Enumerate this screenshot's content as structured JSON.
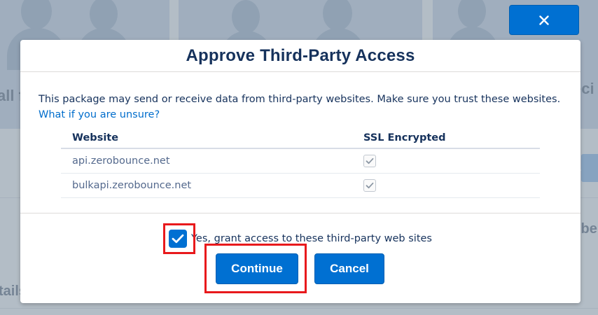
{
  "background": {
    "fragments": [
      "all f",
      "eci",
      "all",
      "ibe",
      "tails"
    ]
  },
  "close_button": {
    "label": "×"
  },
  "modal": {
    "title": "Approve Third-Party Access",
    "description": "This package may send or receive data from third-party websites. Make sure you trust these websites.",
    "help_link": "What if you are unsure?",
    "table": {
      "columns": [
        "Website",
        "SSL Encrypted"
      ],
      "rows": [
        {
          "website": "api.zerobounce.net",
          "ssl_encrypted": true
        },
        {
          "website": "bulkapi.zerobounce.net",
          "ssl_encrypted": true
        }
      ]
    },
    "consent": {
      "label": "Yes, grant access to these third-party web sites",
      "checked": true
    },
    "buttons": {
      "continue": "Continue",
      "cancel": "Cancel"
    }
  },
  "colors": {
    "brand": "#0070d2",
    "title": "#16325c",
    "link": "#006dcc",
    "highlight": "#e8191c"
  },
  "icons": {
    "close": "close-icon",
    "ssl_check": "checkmark-icon",
    "consent_check": "checkmark-icon"
  }
}
